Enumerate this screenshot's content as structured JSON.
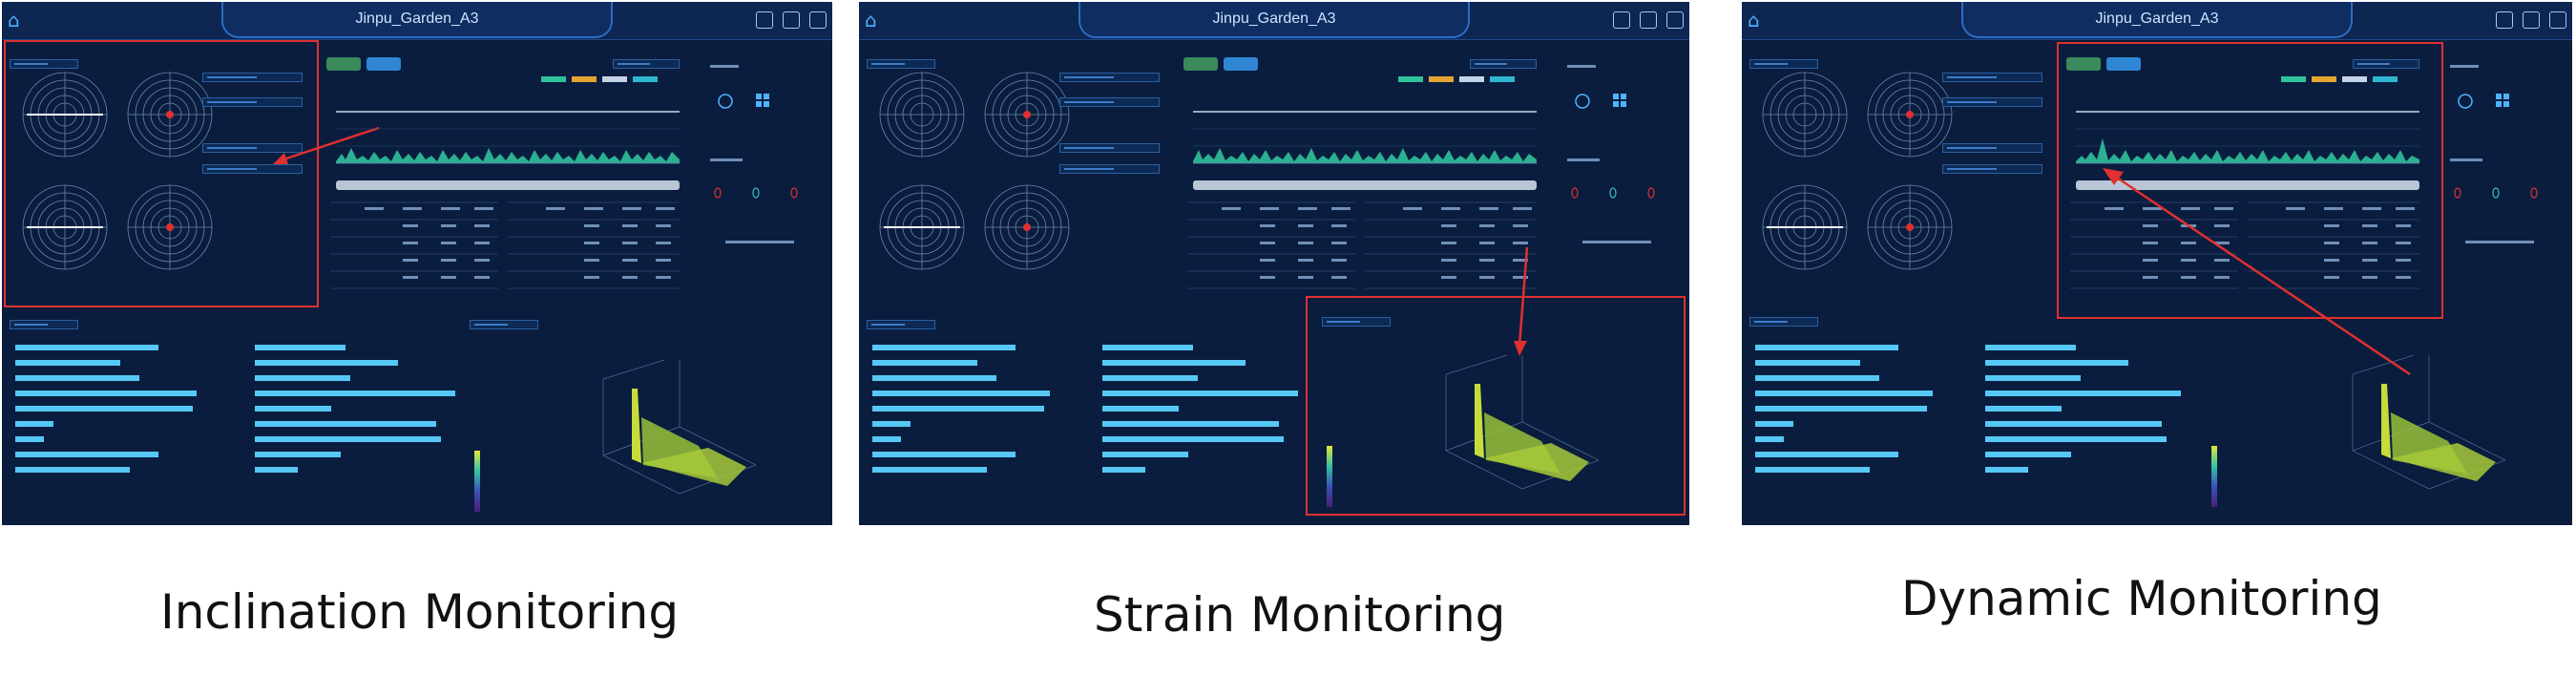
{
  "app": {
    "window_title": "Jinpu_Garden_A3"
  },
  "captions": [
    "Inclination Monitoring",
    "Strain Monitoring",
    "Dynamic Monitoring"
  ],
  "colors": {
    "background": "#0a1d3e",
    "accent": "#2f86d4",
    "bar": "#56c8f5",
    "highlight": "#e03030"
  },
  "icons": [
    "home-icon",
    "logout-icon",
    "shield-icon",
    "settings-icon"
  ]
}
